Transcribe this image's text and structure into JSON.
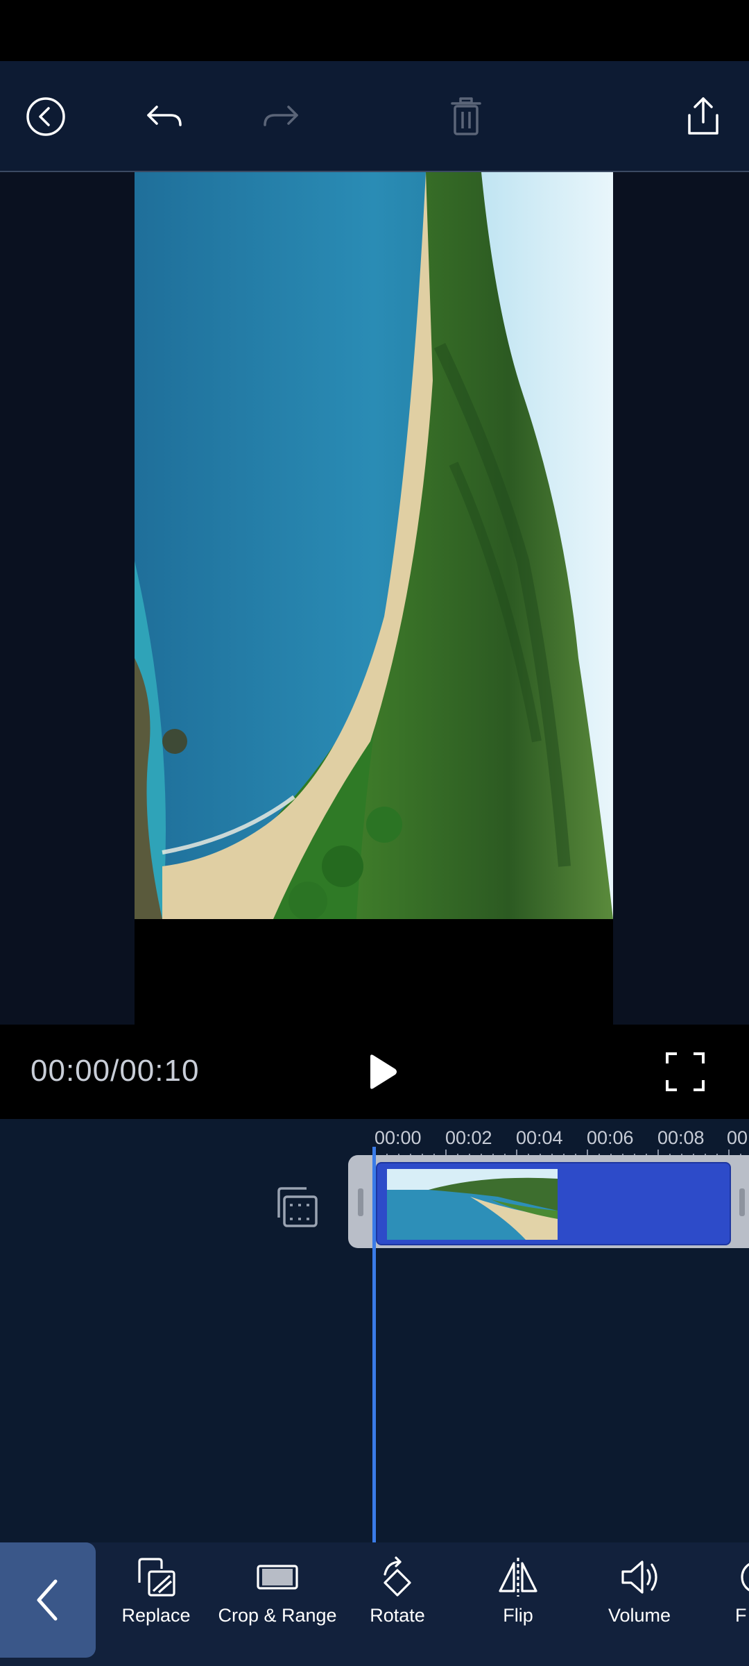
{
  "player": {
    "time_readout": "00:00/00:10"
  },
  "timeline": {
    "ruler_labels": [
      "00:00",
      "00:02",
      "00:04",
      "00:06",
      "00:08",
      "00"
    ]
  },
  "toolbar": {
    "tools": [
      {
        "label": "Replace",
        "icon": "replace-icon"
      },
      {
        "label": "Crop & Range",
        "icon": "crop-icon"
      },
      {
        "label": "Rotate",
        "icon": "rotate-icon"
      },
      {
        "label": "Flip",
        "icon": "flip-icon"
      },
      {
        "label": "Volume",
        "icon": "volume-icon"
      },
      {
        "label": "F",
        "icon": "filter-icon"
      }
    ]
  },
  "colors": {
    "accent": "#3a7be8",
    "clip": "#2d4bc9",
    "background": "#0c1527"
  }
}
